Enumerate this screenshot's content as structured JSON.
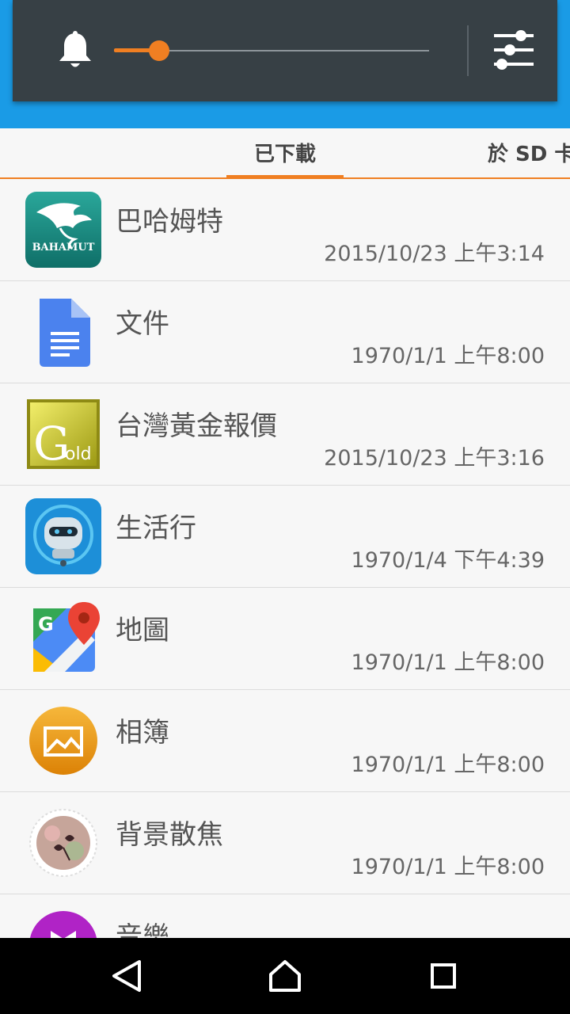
{
  "tabs": [
    {
      "label": "已下載"
    },
    {
      "label": "於 SD 卡"
    }
  ],
  "volume": {
    "level": 0.14
  },
  "colors": {
    "accent": "#f07f22",
    "header_blue": "#1a9be6",
    "panel": "#374045"
  },
  "apps": [
    {
      "name": "巴哈姆特",
      "date": "2015/10/23 上午3:14",
      "icon": "bahamut-icon",
      "icon_text": "BAHAMUT"
    },
    {
      "name": "文件",
      "date": "1970/1/1 上午8:00",
      "icon": "docs-icon"
    },
    {
      "name": "台灣黃金報價",
      "date": "2015/10/23 上午3:16",
      "icon": "gold-icon",
      "icon_text": "old"
    },
    {
      "name": "生活行",
      "date": "1970/1/4 下午4:39",
      "icon": "robot-icon"
    },
    {
      "name": "地圖",
      "date": "1970/1/1 上午8:00",
      "icon": "maps-icon"
    },
    {
      "name": "相簿",
      "date": "1970/1/1 上午8:00",
      "icon": "album-icon"
    },
    {
      "name": "背景散焦",
      "date": "1970/1/1 上午8:00",
      "icon": "background-defocus-icon"
    },
    {
      "name": "音樂",
      "date": "",
      "icon": "music-icon"
    }
  ],
  "navbar": {
    "back": "back-icon",
    "home": "home-icon",
    "recents": "recents-icon"
  }
}
